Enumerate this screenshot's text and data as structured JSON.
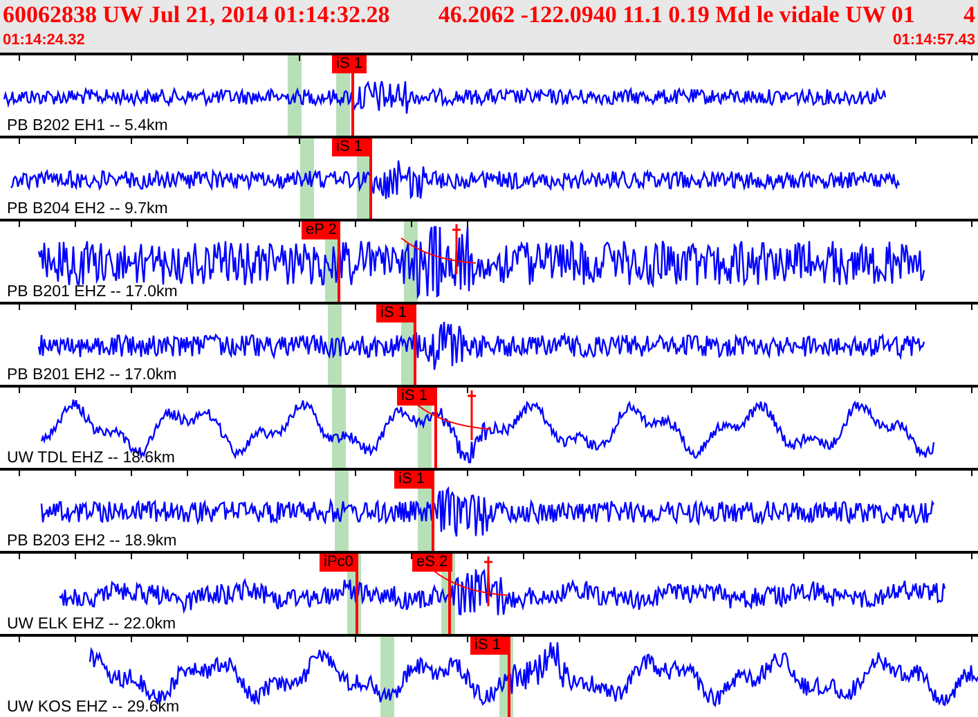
{
  "header": {
    "event": "60062838 UW Jul 21, 2014 01:14:32.28",
    "location": "46.2062 -122.0940 11.1 0.19 Md le vidale UW 01",
    "count": "4"
  },
  "time_range": {
    "start": "01:14:24.32",
    "end": "01:14:57.43"
  },
  "traces": [
    {
      "label": "PB B202 EH1 -- 5.4km",
      "picks": [
        {
          "label": "iS 1"
        }
      ]
    },
    {
      "label": "PB B204 EH2 -- 9.7km",
      "picks": [
        {
          "label": "iS 1"
        }
      ]
    },
    {
      "label": "PB B201 EHZ -- 17.0km",
      "picks": [
        {
          "label": "eP 2"
        }
      ]
    },
    {
      "label": "PB B201 EH2 -- 17.0km",
      "picks": [
        {
          "label": "iS 1"
        }
      ]
    },
    {
      "label": "UW TDL EHZ -- 18.6km",
      "picks": [
        {
          "label": "iS 1"
        }
      ]
    },
    {
      "label": "PB B203 EH2 -- 18.9km",
      "picks": [
        {
          "label": "iS 1"
        }
      ]
    },
    {
      "label": "UW ELK EHZ -- 22.0km",
      "picks": [
        {
          "label": "iPc0"
        },
        {
          "label": "eS 2"
        }
      ]
    },
    {
      "label": "UW KOS EHZ -- 29.6km",
      "picks": [
        {
          "label": "iS 1"
        }
      ]
    }
  ]
}
